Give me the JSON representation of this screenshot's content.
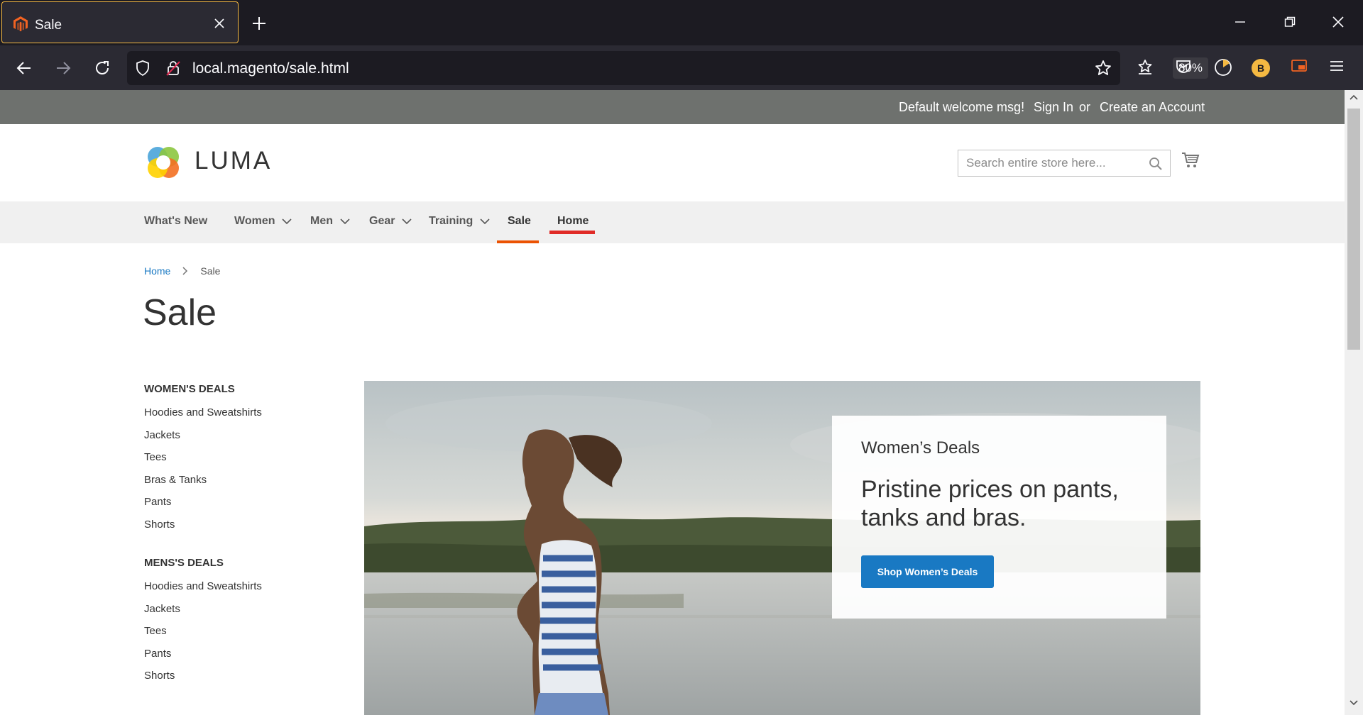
{
  "browser": {
    "tab": {
      "title": "Sale"
    },
    "url": "local.magento/sale.html",
    "zoom": "80%",
    "profile_initial": "B"
  },
  "store": {
    "welcome": "Default welcome msg!",
    "sign_in": "Sign In",
    "or": "or",
    "create_account": "Create an Account",
    "logo_text": "LUMA",
    "search_placeholder": "Search entire store here..."
  },
  "nav": {
    "items": [
      {
        "label": "What's New",
        "has_dropdown": false
      },
      {
        "label": "Women",
        "has_dropdown": true
      },
      {
        "label": "Men",
        "has_dropdown": true
      },
      {
        "label": "Gear",
        "has_dropdown": true
      },
      {
        "label": "Training",
        "has_dropdown": true
      },
      {
        "label": "Sale",
        "has_dropdown": false,
        "active": true
      },
      {
        "label": "Home",
        "has_dropdown": false
      }
    ]
  },
  "breadcrumb": {
    "home": "Home",
    "current": "Sale"
  },
  "page_title": "Sale",
  "sidebar": {
    "groups": [
      {
        "heading": "WOMEN'S DEALS",
        "links": [
          "Hoodies and Sweatshirts",
          "Jackets",
          "Tees",
          "Bras & Tanks",
          "Pants",
          "Shorts"
        ]
      },
      {
        "heading": "MENS'S DEALS",
        "links": [
          "Hoodies and Sweatshirts",
          "Jackets",
          "Tees",
          "Pants",
          "Shorts"
        ]
      }
    ]
  },
  "promo": {
    "eyebrow": "Women’s Deals",
    "headline": "Pristine prices on pants, tanks and bras.",
    "button": "Shop Women’s Deals"
  },
  "colors": {
    "brand_blue": "#1979c3",
    "sale_underline": "#eb5202",
    "home_underline": "#e02b27",
    "browser_accent": "#f5b942"
  }
}
